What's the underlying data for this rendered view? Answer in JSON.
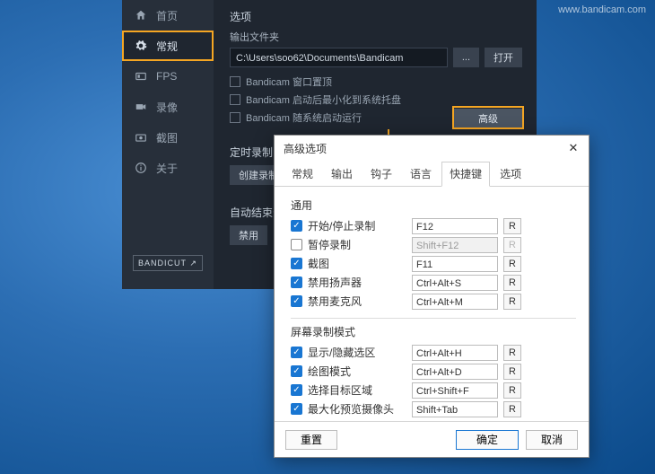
{
  "watermark": "www.bandicam.com",
  "sidebar": {
    "items": [
      {
        "label": "首页"
      },
      {
        "label": "常规"
      },
      {
        "label": "FPS"
      },
      {
        "label": "录像"
      },
      {
        "label": "截图"
      },
      {
        "label": "关于"
      }
    ],
    "bandicut": "BANDICUT ↗"
  },
  "main": {
    "options_title": "选项",
    "output_label": "输出文件夹",
    "path": "C:\\Users\\soo62\\Documents\\Bandicam",
    "browse": "...",
    "open": "打开",
    "chk1": "Bandicam 窗口置顶",
    "chk2": "Bandicam 启动后最小化到系统托盘",
    "chk3": "Bandicam 随系统启动运行",
    "advanced": "高级",
    "timer_title": "定时录制",
    "timer_btn": "创建录制",
    "autoend_title": "自动结束录",
    "autoend_btn": "禁用"
  },
  "dialog": {
    "title": "高级选项",
    "tabs": [
      "常规",
      "输出",
      "钩子",
      "语言",
      "快捷键",
      "选项"
    ],
    "active_tab": 4,
    "group_general": "通用",
    "group_screen": "屏幕录制模式",
    "rows_general": [
      {
        "on": true,
        "label": "开始/停止录制",
        "key": "F12",
        "disabled": false
      },
      {
        "on": false,
        "label": "暂停录制",
        "key": "Shift+F12",
        "disabled": true
      },
      {
        "on": true,
        "label": "截图",
        "key": "F11",
        "disabled": false
      },
      {
        "on": true,
        "label": "禁用扬声器",
        "key": "Ctrl+Alt+S",
        "disabled": false
      },
      {
        "on": true,
        "label": "禁用麦克风",
        "key": "Ctrl+Alt+M",
        "disabled": false
      }
    ],
    "rows_screen": [
      {
        "on": true,
        "label": "显示/隐藏选区",
        "key": "Ctrl+Alt+H",
        "disabled": false
      },
      {
        "on": true,
        "label": "绘图模式",
        "key": "Ctrl+Alt+D",
        "disabled": false
      },
      {
        "on": true,
        "label": "选择目标区域",
        "key": "Ctrl+Shift+F",
        "disabled": false
      },
      {
        "on": true,
        "label": "最大化预览摄像头",
        "key": "Shift+Tab",
        "disabled": false
      }
    ],
    "reset_char": "R",
    "btn_reset": "重置",
    "btn_ok": "确定",
    "btn_cancel": "取消"
  }
}
